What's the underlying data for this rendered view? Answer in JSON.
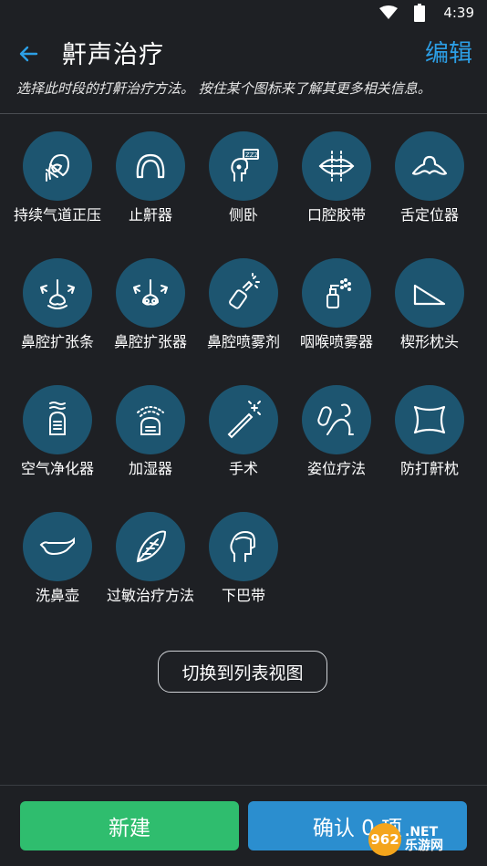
{
  "status": {
    "time": "4:39"
  },
  "header": {
    "title": "鼾声治疗",
    "edit": "编辑"
  },
  "hint": "选择此时段的打鼾治疗方法。 按住某个图标来了解其更多相关信息。",
  "remedies": [
    {
      "label": "持续气道正压",
      "icon": "cpap-mask-icon"
    },
    {
      "label": "止鼾器",
      "icon": "mouthguard-icon"
    },
    {
      "label": "侧卧",
      "icon": "side-sleep-icon"
    },
    {
      "label": "口腔胶带",
      "icon": "mouth-tape-icon"
    },
    {
      "label": "舌定位器",
      "icon": "tongue-retainer-icon"
    },
    {
      "label": "鼻腔扩张条",
      "icon": "nasal-strip-icon"
    },
    {
      "label": "鼻腔扩张器",
      "icon": "nasal-dilator-icon"
    },
    {
      "label": "鼻腔喷雾剂",
      "icon": "nasal-spray-icon"
    },
    {
      "label": "咽喉喷雾器",
      "icon": "throat-spray-icon"
    },
    {
      "label": "楔形枕头",
      "icon": "wedge-pillow-icon"
    },
    {
      "label": "空气净化器",
      "icon": "air-purifier-icon"
    },
    {
      "label": "加湿器",
      "icon": "humidifier-icon"
    },
    {
      "label": "手术",
      "icon": "surgery-icon"
    },
    {
      "label": "姿位疗法",
      "icon": "positional-therapy-icon"
    },
    {
      "label": "防打鼾枕",
      "icon": "anti-snore-pillow-icon"
    },
    {
      "label": "洗鼻壶",
      "icon": "neti-pot-icon"
    },
    {
      "label": "过敏治疗方法",
      "icon": "allergy-treatment-icon"
    },
    {
      "label": "下巴带",
      "icon": "chin-strap-icon"
    }
  ],
  "toggle_view": "切换到列表视图",
  "footer": {
    "new": "新建",
    "confirm": "确认 0 项"
  },
  "watermark": {
    "badge": "962",
    "text1": ".NET",
    "text2": "乐游网"
  },
  "colors": {
    "background": "#1e2024",
    "circle": "#1d5570",
    "accent": "#2c9fe6",
    "new_button": "#2fbd6e",
    "confirm_button": "#2b8ecf"
  }
}
